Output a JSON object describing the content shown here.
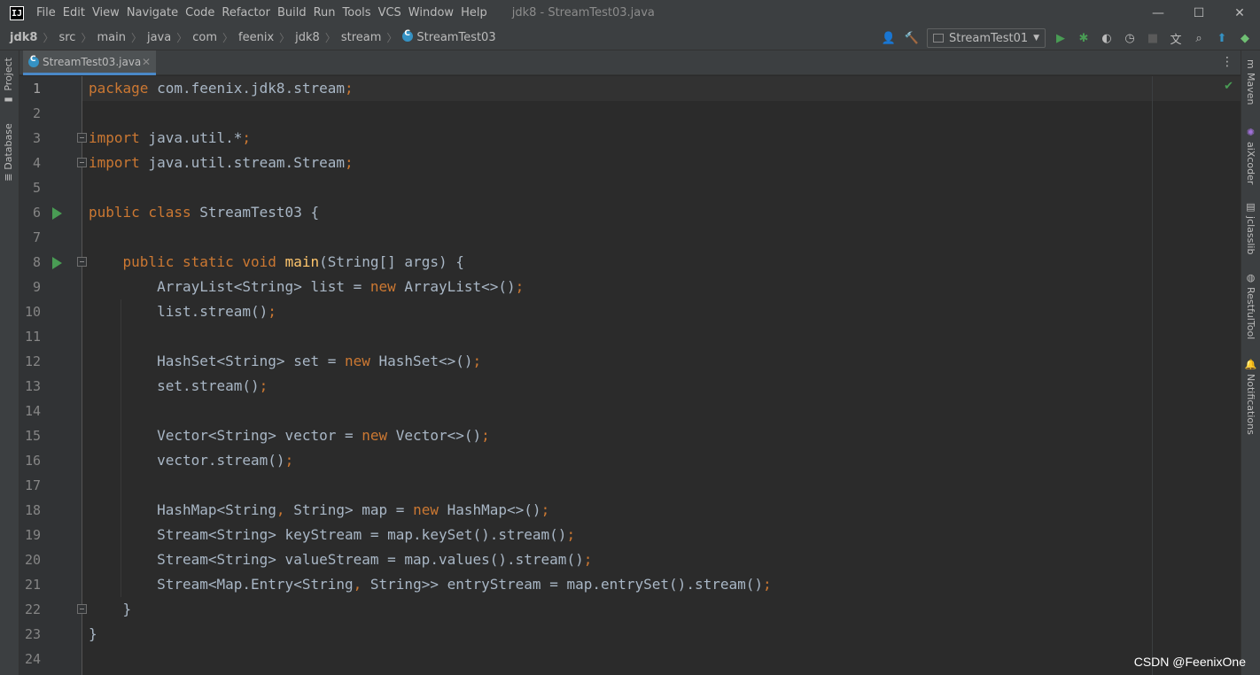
{
  "titlebar": {
    "app_icon_text": "IJ",
    "menu": [
      "File",
      "Edit",
      "View",
      "Navigate",
      "Code",
      "Refactor",
      "Build",
      "Run",
      "Tools",
      "VCS",
      "Window",
      "Help"
    ],
    "window_title": "jdk8 - StreamTest03.java",
    "minimize": "—",
    "maximize": "☐",
    "close": "✕"
  },
  "navbar": {
    "breadcrumbs": [
      "jdk8",
      "src",
      "main",
      "java",
      "com",
      "feenix",
      "jdk8",
      "stream",
      "StreamTest03"
    ],
    "run_config": "StreamTest01"
  },
  "left_tools": [
    "Project",
    "Database"
  ],
  "right_tools": [
    "Maven",
    "aiXcoder",
    "jclasslib",
    "RestfulTool",
    "Notifications"
  ],
  "tab": {
    "label": "StreamTest03.java",
    "close": "✕"
  },
  "editor": {
    "lines": [
      {
        "n": "1",
        "tokens": [
          [
            "kw",
            "package"
          ],
          [
            "p",
            " com.feenix.jdk8.stream"
          ],
          [
            "pn",
            ";"
          ]
        ]
      },
      {
        "n": "2",
        "tokens": []
      },
      {
        "n": "3",
        "tokens": [
          [
            "kw",
            "import"
          ],
          [
            "p",
            " java.util.*"
          ],
          [
            "pn",
            ";"
          ]
        ]
      },
      {
        "n": "4",
        "tokens": [
          [
            "kw",
            "import"
          ],
          [
            "p",
            " java.util.stream.Stream"
          ],
          [
            "pn",
            ";"
          ]
        ]
      },
      {
        "n": "5",
        "tokens": []
      },
      {
        "n": "6",
        "tokens": [
          [
            "kw",
            "public class"
          ],
          [
            "p",
            " StreamTest03 {"
          ]
        ]
      },
      {
        "n": "7",
        "tokens": []
      },
      {
        "n": "8",
        "tokens": [
          [
            "p",
            "    "
          ],
          [
            "kw",
            "public static void"
          ],
          [
            "p",
            " "
          ],
          [
            "fn",
            "main"
          ],
          [
            "p",
            "(String[] args) {"
          ]
        ]
      },
      {
        "n": "9",
        "tokens": [
          [
            "p",
            "        ArrayList<String> list = "
          ],
          [
            "kw",
            "new"
          ],
          [
            "p",
            " ArrayList<>()"
          ],
          [
            "pn",
            ";"
          ]
        ]
      },
      {
        "n": "10",
        "tokens": [
          [
            "p",
            "        list.stream()"
          ],
          [
            "pn",
            ";"
          ]
        ]
      },
      {
        "n": "11",
        "tokens": []
      },
      {
        "n": "12",
        "tokens": [
          [
            "p",
            "        HashSet<String> set = "
          ],
          [
            "kw",
            "new"
          ],
          [
            "p",
            " HashSet<>()"
          ],
          [
            "pn",
            ";"
          ]
        ]
      },
      {
        "n": "13",
        "tokens": [
          [
            "p",
            "        set.stream()"
          ],
          [
            "pn",
            ";"
          ]
        ]
      },
      {
        "n": "14",
        "tokens": []
      },
      {
        "n": "15",
        "tokens": [
          [
            "p",
            "        Vector<String> vector = "
          ],
          [
            "kw",
            "new"
          ],
          [
            "p",
            " Vector<>()"
          ],
          [
            "pn",
            ";"
          ]
        ]
      },
      {
        "n": "16",
        "tokens": [
          [
            "p",
            "        vector.stream()"
          ],
          [
            "pn",
            ";"
          ]
        ]
      },
      {
        "n": "17",
        "tokens": []
      },
      {
        "n": "18",
        "tokens": [
          [
            "p",
            "        HashMap<String"
          ],
          [
            "pn",
            ","
          ],
          [
            "p",
            " String> map = "
          ],
          [
            "kw",
            "new"
          ],
          [
            "p",
            " HashMap<>()"
          ],
          [
            "pn",
            ";"
          ]
        ]
      },
      {
        "n": "19",
        "tokens": [
          [
            "p",
            "        Stream<String> keyStream = map.keySet().stream()"
          ],
          [
            "pn",
            ";"
          ]
        ]
      },
      {
        "n": "20",
        "tokens": [
          [
            "p",
            "        Stream<String> valueStream = map.values().stream()"
          ],
          [
            "pn",
            ";"
          ]
        ]
      },
      {
        "n": "21",
        "tokens": [
          [
            "p",
            "        Stream<Map.Entry<String"
          ],
          [
            "pn",
            ","
          ],
          [
            "p",
            " String>> entryStream = map.entrySet().stream()"
          ],
          [
            "pn",
            ";"
          ]
        ]
      },
      {
        "n": "22",
        "tokens": [
          [
            "p",
            "    }"
          ]
        ]
      },
      {
        "n": "23",
        "tokens": [
          [
            "p",
            "}"
          ]
        ]
      },
      {
        "n": "24",
        "tokens": []
      }
    ],
    "run_markers": [
      "6",
      "8"
    ],
    "fold_markers": [
      "3",
      "4",
      "8",
      "22"
    ]
  },
  "watermark": "CSDN @FeenixOne",
  "colors": {
    "keyword": "#cc7832",
    "method": "#ffc66d",
    "text": "#a9b7c6",
    "background": "#2b2b2b"
  }
}
